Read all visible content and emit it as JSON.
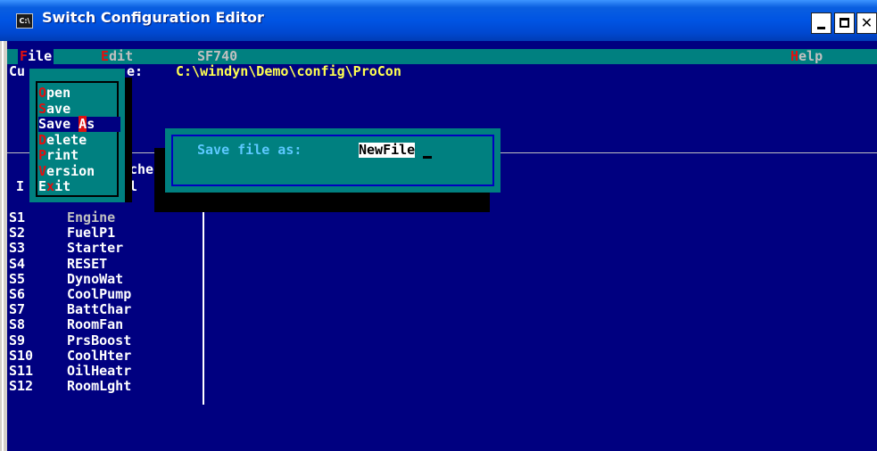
{
  "window": {
    "title": "Switch Configuration Editor",
    "icon_text": "C:\\"
  },
  "menubar": {
    "file": "File",
    "edit": "Edit",
    "model": "SF740",
    "help": "Help"
  },
  "current_file": {
    "label_prefix": "Cu",
    "label_suffix": "e:",
    "path": "C:\\windyn\\Demo\\config\\ProCon"
  },
  "file_menu": {
    "items": [
      {
        "key": "O",
        "rest": "pen"
      },
      {
        "key": "S",
        "rest": "ave"
      },
      {
        "pre": "Save ",
        "key": "A",
        "rest": "s",
        "selected": true
      },
      {
        "key": "D",
        "rest": "elete"
      },
      {
        "key": "P",
        "rest": "rint"
      },
      {
        "key": "V",
        "rest": "ersion"
      },
      {
        "pre": "E",
        "key": "x",
        "rest": "it"
      }
    ]
  },
  "partial_header": {
    "line1": "che",
    "line2_left": "I",
    "line2_right": "l"
  },
  "save_dialog": {
    "label": "Save file as:",
    "value": "NewFile"
  },
  "switches": [
    {
      "id": "S1",
      "name": "Engine"
    },
    {
      "id": "S2",
      "name": "FuelP1"
    },
    {
      "id": "S3",
      "name": "Starter"
    },
    {
      "id": "S4",
      "name": "RESET"
    },
    {
      "id": "S5",
      "name": "DynoWat"
    },
    {
      "id": "S6",
      "name": "CoolPump"
    },
    {
      "id": "S7",
      "name": "BattChar"
    },
    {
      "id": "S8",
      "name": "RoomFan"
    },
    {
      "id": "S9",
      "name": "PrsBoost"
    },
    {
      "id": "S10",
      "name": "CoolHter"
    },
    {
      "id": "S11",
      "name": "OilHeatr"
    },
    {
      "id": "S12",
      "name": "RoomLght"
    }
  ],
  "colors": {
    "console_bg": "#000080",
    "menubar_bg": "#008080",
    "hotkey": "#e01010",
    "path": "#ffff50"
  }
}
